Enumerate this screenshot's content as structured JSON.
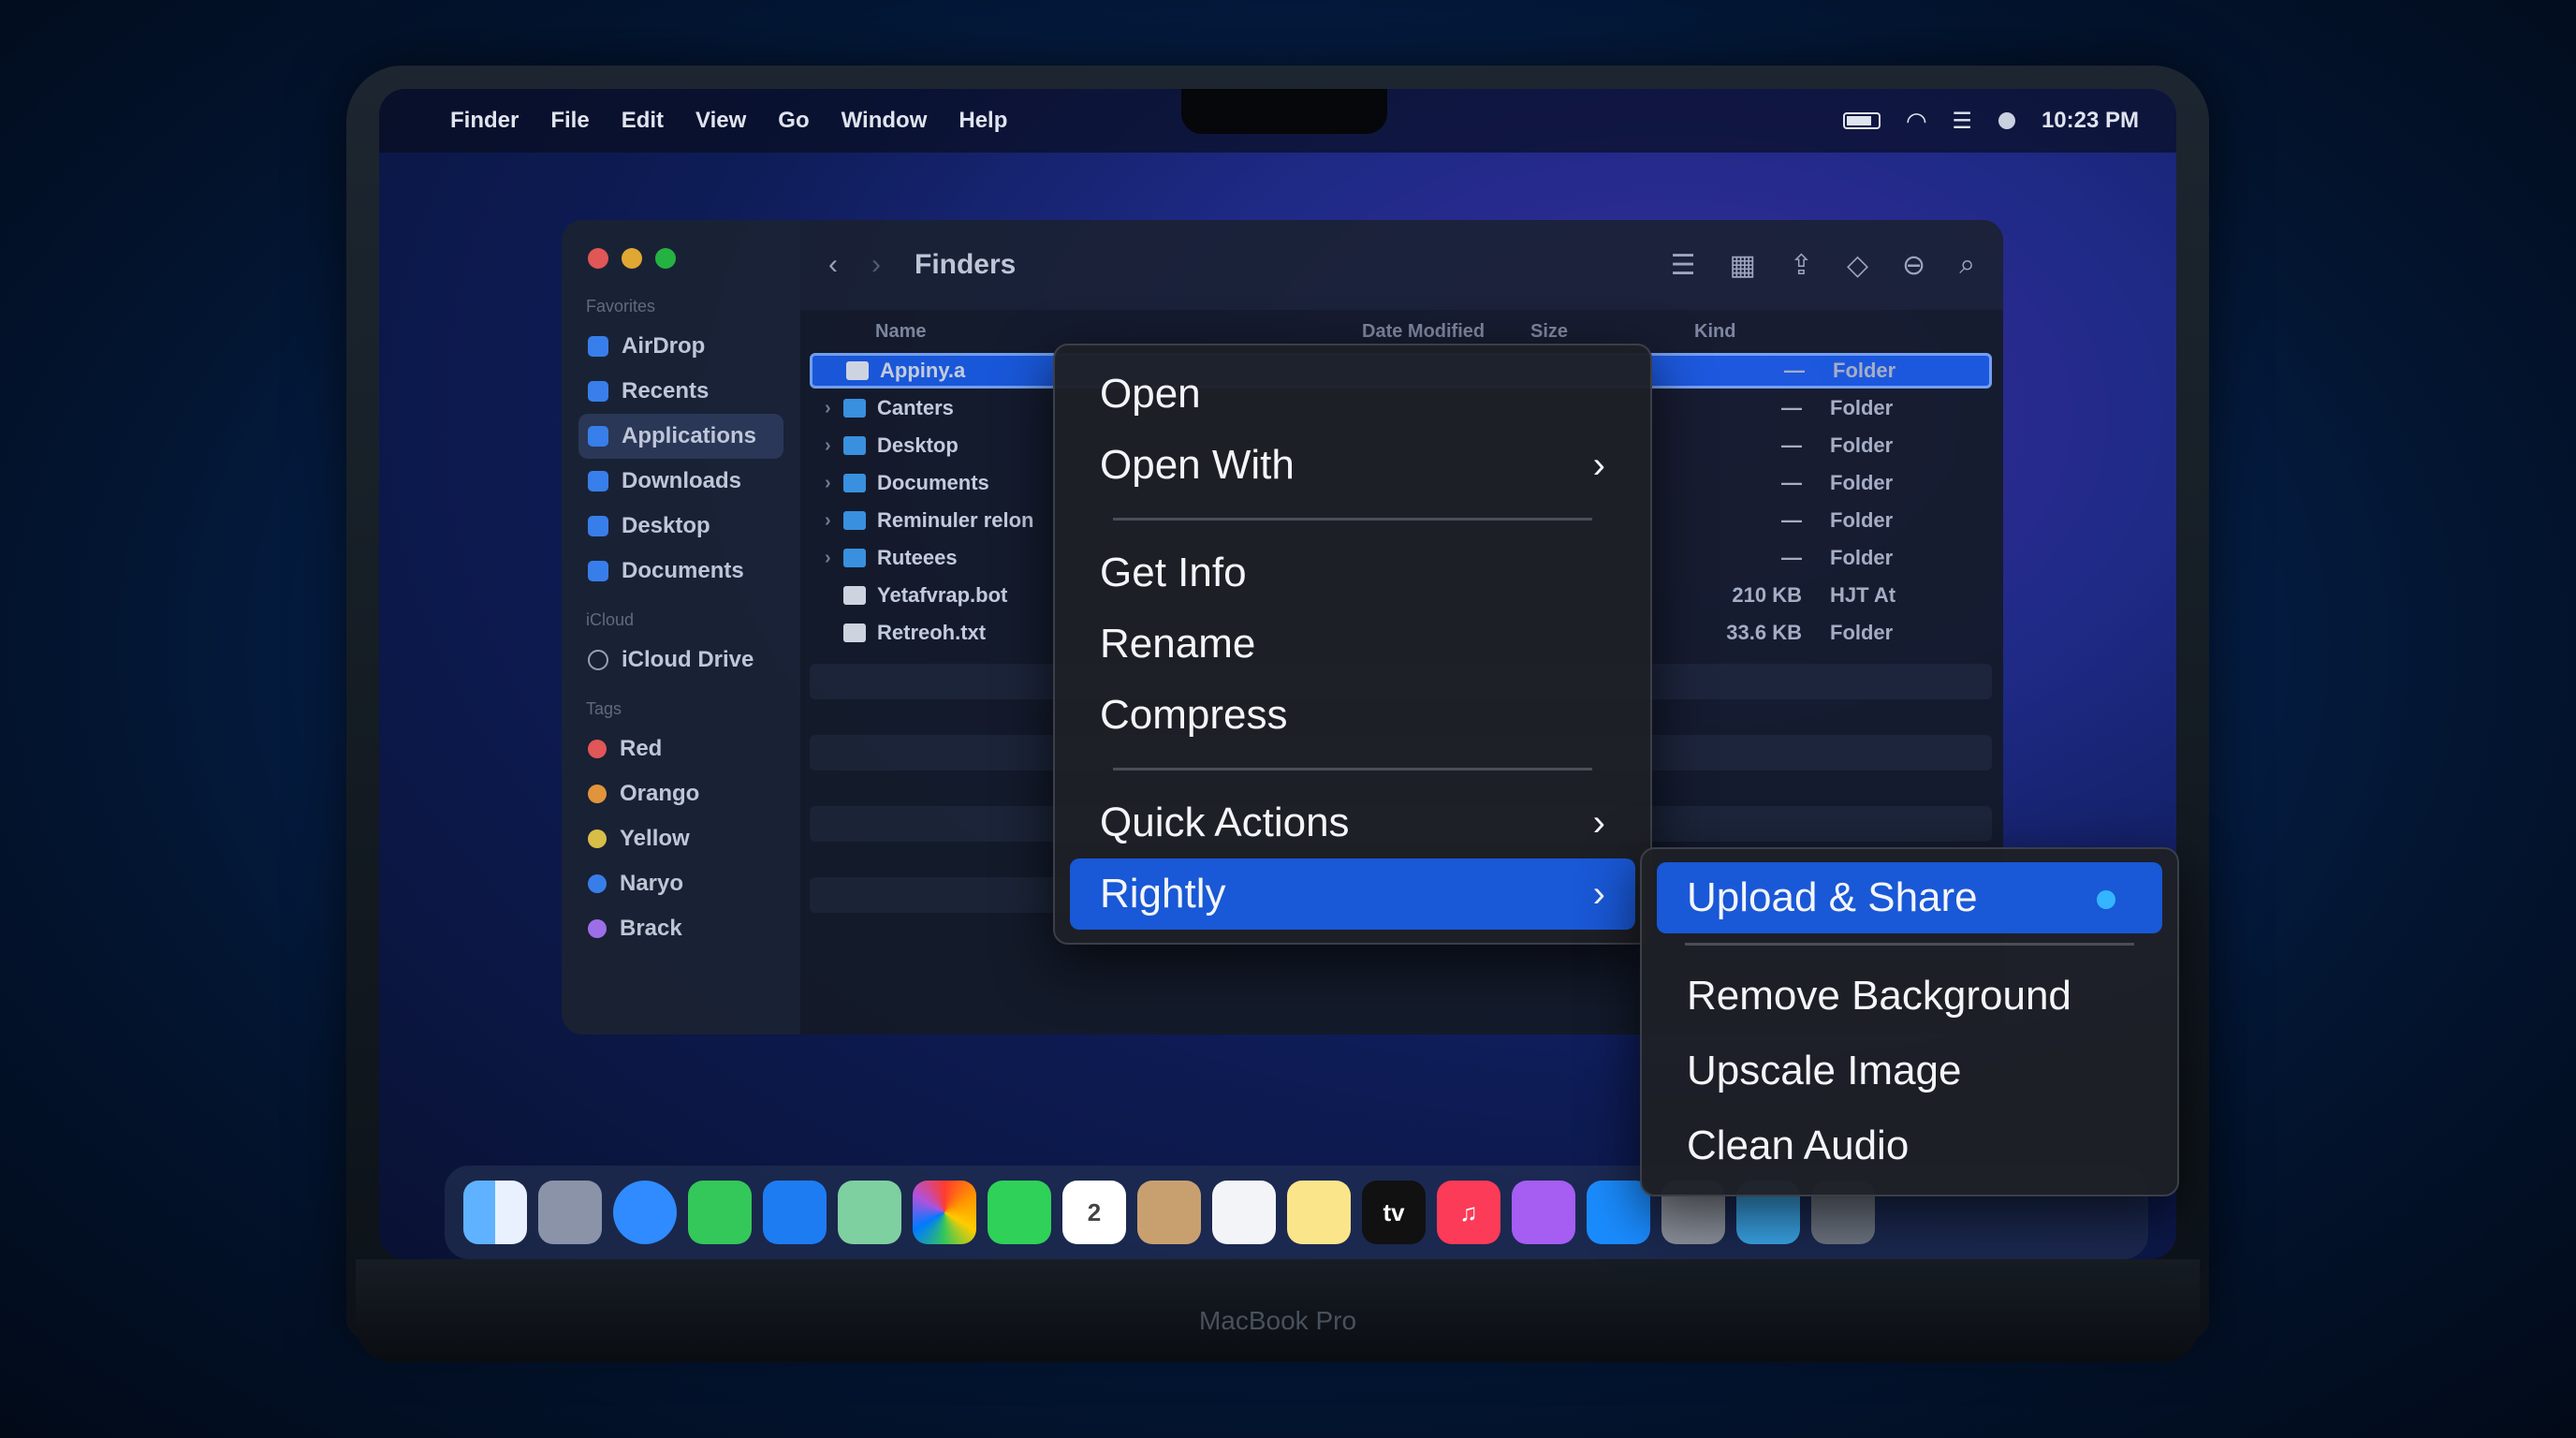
{
  "menubar": {
    "items": [
      "Finder",
      "File",
      "Edit",
      "View",
      "Go",
      "Window",
      "Help"
    ],
    "clock": "10:23 PM"
  },
  "finder": {
    "title": "Finders",
    "sidebar": {
      "favorites_label": "Favorites",
      "favorites": [
        "AirDrop",
        "Recents",
        "Applications",
        "Downloads",
        "Desktop",
        "Documents"
      ],
      "icloud_label": "iCloud",
      "icloud": [
        "iCloud Drive"
      ],
      "tags_label": "Tags",
      "tags": [
        {
          "name": "Red",
          "color": "#ff5f57"
        },
        {
          "name": "Orango",
          "color": "#ffa53a"
        },
        {
          "name": "Yellow",
          "color": "#f5d547"
        },
        {
          "name": "Naryo",
          "color": "#3f8cff"
        },
        {
          "name": "Brack",
          "color": "#b07cff"
        }
      ]
    },
    "columns": {
      "name": "Name",
      "date": "Date Modified",
      "size": "Size",
      "kind": "Kind"
    },
    "rows": [
      {
        "name": "Appiny.a",
        "size": "—",
        "kind": "Folder"
      },
      {
        "name": "Canters",
        "size": "—",
        "kind": "Folder"
      },
      {
        "name": "Desktop",
        "size": "—",
        "kind": "Folder"
      },
      {
        "name": "Documents",
        "size": "—",
        "kind": "Folder"
      },
      {
        "name": "Reminuler relon",
        "size": "—",
        "kind": "Folder"
      },
      {
        "name": "Ruteees",
        "size": "—",
        "kind": "Folder"
      },
      {
        "name": "Yetafvrap.bot",
        "size": "210 KB",
        "kind": "HJT At"
      },
      {
        "name": "Retreoh.txt",
        "size": "33.6 KB",
        "kind": "Folder"
      }
    ]
  },
  "context_menu": {
    "items": [
      "Open",
      "Open With",
      "Get Info",
      "Rename",
      "Compress",
      "Quick Actions",
      "Rightly"
    ]
  },
  "submenu": {
    "items": [
      "Upload & Share",
      "Remove Background",
      "Upscale Image",
      "Clean Audio"
    ]
  },
  "dock": {
    "tv_label": "tv",
    "calendar_day": "2"
  },
  "device_label": "MacBook Pro"
}
